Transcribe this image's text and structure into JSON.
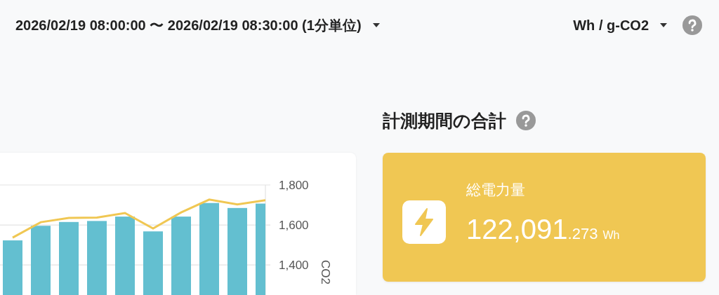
{
  "header": {
    "period": {
      "label": "2026/02/19 08:00:00 〜 2026/02/19 08:30:00 (1分単位)"
    },
    "unit": {
      "label": "Wh / g-CO2"
    }
  },
  "chart": {
    "chart_data": {
      "type": "bar",
      "ylabel": "CO2",
      "ylim": [
        1250,
        1800
      ],
      "yticks": [
        {
          "value": 1400,
          "label": "1,400"
        },
        {
          "value": 1600,
          "label": "1,600"
        },
        {
          "value": 1800,
          "label": "1,800"
        }
      ],
      "series": [
        {
          "type": "bar",
          "color": "#63bfd0",
          "values": [
            1523,
            1596,
            1615,
            1620,
            1642,
            1568,
            1642,
            1710,
            1685,
            1707
          ]
        },
        {
          "type": "line",
          "color": "#f0c753",
          "values": [
            1537,
            1614,
            1635,
            1637,
            1660,
            1583,
            1663,
            1727,
            1703,
            1724
          ]
        }
      ]
    }
  },
  "summary": {
    "title": "計測期間の合計",
    "card": {
      "label": "総電力量",
      "integer": "122,091",
      "decimal": ".273",
      "unit": "Wh"
    }
  }
}
